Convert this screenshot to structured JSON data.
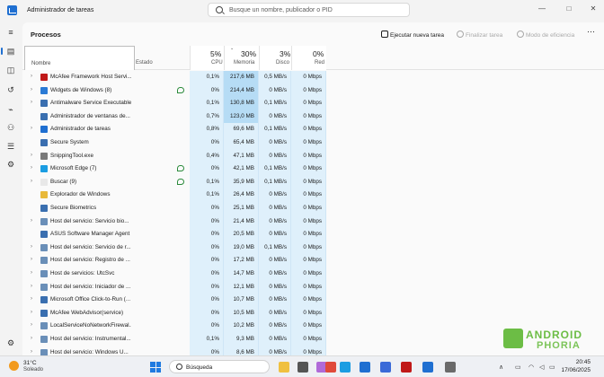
{
  "window": {
    "title": "Administrador de tareas",
    "search_placeholder": "Busque un nombre, publicador o PID",
    "controls": {
      "minimize": "—",
      "maximize": "□",
      "close": "✕"
    }
  },
  "nav": {
    "items": [
      {
        "icon": "hamburger-menu-icon",
        "glyph": "≡"
      },
      {
        "icon": "processes-icon",
        "glyph": "▤",
        "active": true
      },
      {
        "icon": "performance-icon",
        "glyph": "◫"
      },
      {
        "icon": "app-history-icon",
        "glyph": "↺"
      },
      {
        "icon": "startup-apps-icon",
        "glyph": "⌁"
      },
      {
        "icon": "users-icon",
        "glyph": "⚇"
      },
      {
        "icon": "details-icon",
        "glyph": "☰"
      },
      {
        "icon": "services-icon",
        "glyph": "⚙"
      }
    ],
    "settings_icon": "⚙"
  },
  "toolbar": {
    "page_title": "Procesos",
    "run_new_task": "Ejecutar nueva tarea",
    "end_task": "Finalizar tarea",
    "efficiency_mode": "Modo de eficiencia",
    "more": "⋯"
  },
  "table": {
    "columns": {
      "name": "Nombre",
      "status": "Estado",
      "cpu": {
        "pct": "5%",
        "label": "CPU"
      },
      "memory": {
        "pct": "30%",
        "label": "Memoria"
      },
      "disk": {
        "pct": "3%",
        "label": "Disco"
      },
      "network": {
        "pct": "0%",
        "label": "Red"
      }
    },
    "rows": [
      {
        "name": "McAfee Framework Host Servi...",
        "expandable": true,
        "cpu": "0,1%",
        "mem": "217,6 MB",
        "disk": "0,5 MB/s",
        "net": "0 Mbps",
        "icon_color": "#c01818",
        "eco": false,
        "mem_dark": true
      },
      {
        "name": "Widgets de Windows (8)",
        "expandable": true,
        "cpu": "0%",
        "mem": "214,4 MB",
        "disk": "0 MB/s",
        "net": "0 Mbps",
        "icon_color": "#2a7ad5",
        "eco": true,
        "mem_dark": true
      },
      {
        "name": "Antimalware Service Executable",
        "expandable": true,
        "cpu": "0,1%",
        "mem": "130,8 MB",
        "disk": "0,1 MB/s",
        "net": "0 Mbps",
        "icon_color": "#3a6fb0",
        "eco": false,
        "mem_dark": true
      },
      {
        "name": "Administrador de ventanas de...",
        "expandable": false,
        "cpu": "0,7%",
        "mem": "123,0 MB",
        "disk": "0 MB/s",
        "net": "0 Mbps",
        "icon_color": "#3a6fb0",
        "eco": false,
        "mem_dark": true
      },
      {
        "name": "Administrador de tareas",
        "expandable": true,
        "cpu": "0,8%",
        "mem": "69,6 MB",
        "disk": "0,1 MB/s",
        "net": "0 Mbps",
        "icon_color": "#1f6fd1",
        "eco": false,
        "mem_dark": false
      },
      {
        "name": "Secure System",
        "expandable": false,
        "cpu": "0%",
        "mem": "65,4 MB",
        "disk": "0 MB/s",
        "net": "0 Mbps",
        "icon_color": "#3a6fb0",
        "eco": false,
        "mem_dark": false
      },
      {
        "name": "SnippingTool.exe",
        "expandable": true,
        "cpu": "0,4%",
        "mem": "47,1 MB",
        "disk": "0 MB/s",
        "net": "0 Mbps",
        "icon_color": "#7a7a7a",
        "eco": false,
        "mem_dark": false
      },
      {
        "name": "Microsoft Edge (7)",
        "expandable": true,
        "cpu": "0%",
        "mem": "42,1 MB",
        "disk": "0,1 MB/s",
        "net": "0 Mbps",
        "icon_color": "#1b9de2",
        "eco": true,
        "mem_dark": false
      },
      {
        "name": "Buscar (9)",
        "expandable": true,
        "cpu": "0,1%",
        "mem": "35,9 MB",
        "disk": "0,1 MB/s",
        "net": "0 Mbps",
        "icon_color": "#e8e8e8",
        "eco": true,
        "mem_dark": false
      },
      {
        "name": "Explorador de Windows",
        "expandable": false,
        "cpu": "0,1%",
        "mem": "26,4 MB",
        "disk": "0 MB/s",
        "net": "0 Mbps",
        "icon_color": "#e8b93a",
        "eco": false,
        "mem_dark": false
      },
      {
        "name": "Secure Biometrics",
        "expandable": false,
        "cpu": "0%",
        "mem": "25,1 MB",
        "disk": "0 MB/s",
        "net": "0 Mbps",
        "icon_color": "#3a6fb0",
        "eco": false,
        "mem_dark": false
      },
      {
        "name": "Host del servicio: Servicio bio...",
        "expandable": true,
        "cpu": "0%",
        "mem": "21,4 MB",
        "disk": "0 MB/s",
        "net": "0 Mbps",
        "icon_color": "#6a8fb8",
        "eco": false,
        "mem_dark": false
      },
      {
        "name": "ASUS Software Manager Agent",
        "expandable": false,
        "cpu": "0%",
        "mem": "20,5 MB",
        "disk": "0 MB/s",
        "net": "0 Mbps",
        "icon_color": "#3a6fb0",
        "eco": false,
        "mem_dark": false
      },
      {
        "name": "Host del servicio: Servicio de r...",
        "expandable": true,
        "cpu": "0%",
        "mem": "19,0 MB",
        "disk": "0,1 MB/s",
        "net": "0 Mbps",
        "icon_color": "#6a8fb8",
        "eco": false,
        "mem_dark": false
      },
      {
        "name": "Host del servicio: Registro de ...",
        "expandable": true,
        "cpu": "0%",
        "mem": "17,2 MB",
        "disk": "0 MB/s",
        "net": "0 Mbps",
        "icon_color": "#6a8fb8",
        "eco": false,
        "mem_dark": false
      },
      {
        "name": "Host de servicios: UtcSvc",
        "expandable": true,
        "cpu": "0%",
        "mem": "14,7 MB",
        "disk": "0 MB/s",
        "net": "0 Mbps",
        "icon_color": "#6a8fb8",
        "eco": false,
        "mem_dark": false
      },
      {
        "name": "Host del servicio: Iniciador de ...",
        "expandable": true,
        "cpu": "0%",
        "mem": "12,1 MB",
        "disk": "0 MB/s",
        "net": "0 Mbps",
        "icon_color": "#6a8fb8",
        "eco": false,
        "mem_dark": false
      },
      {
        "name": "Microsoft Office Click-to-Run (...",
        "expandable": true,
        "cpu": "0%",
        "mem": "10,7 MB",
        "disk": "0 MB/s",
        "net": "0 Mbps",
        "icon_color": "#3a6fb0",
        "eco": false,
        "mem_dark": false
      },
      {
        "name": "McAfee WebAdvisor(service)",
        "expandable": true,
        "cpu": "0%",
        "mem": "10,5 MB",
        "disk": "0 MB/s",
        "net": "0 Mbps",
        "icon_color": "#3a6fb0",
        "eco": false,
        "mem_dark": false
      },
      {
        "name": "LocalServiceNoNetworkFirewal...",
        "expandable": true,
        "cpu": "0%",
        "mem": "10,2 MB",
        "disk": "0 MB/s",
        "net": "0 Mbps",
        "icon_color": "#6a8fb8",
        "eco": false,
        "mem_dark": false
      },
      {
        "name": "Host del servicio: Instrumental...",
        "expandable": true,
        "cpu": "0,1%",
        "mem": "9,3 MB",
        "disk": "0 MB/s",
        "net": "0 Mbps",
        "icon_color": "#6a8fb8",
        "eco": false,
        "mem_dark": false
      },
      {
        "name": "Host del servicio: Windows U...",
        "expandable": true,
        "cpu": "0%",
        "mem": "8,6 MB",
        "disk": "0 MB/s",
        "net": "0 Mbps",
        "icon_color": "#6a8fb8",
        "eco": false,
        "mem_dark": false
      }
    ]
  },
  "watermark": {
    "line1": "ANDROID",
    "line2": "PHORIA"
  },
  "taskbar": {
    "weather_temp": "31°C",
    "weather_desc": "Soleado",
    "search_label": "Búsqueda",
    "tray_chevron": "∧",
    "time": "20:45",
    "date": "17/06/2025",
    "apps": [
      {
        "icon": "file-explorer-icon",
        "color": "#f0c040"
      },
      {
        "icon": "task-view-icon",
        "color": "#555555"
      },
      {
        "icon": "copilot-icon",
        "color": "#b06ad8"
      },
      {
        "icon": "chrome-icon",
        "color": "#e04a3a"
      },
      {
        "icon": "edge-icon",
        "color": "#1b9de2"
      },
      {
        "icon": "photos-icon",
        "color": "#1f6fd1"
      },
      {
        "icon": "store-icon",
        "color": "#3a6ad8"
      },
      {
        "icon": "mcafee-icon",
        "color": "#c01818"
      },
      {
        "icon": "task-manager-icon",
        "color": "#1f6fd1"
      },
      {
        "icon": "settings-icon",
        "color": "#6a6a6a"
      }
    ]
  }
}
